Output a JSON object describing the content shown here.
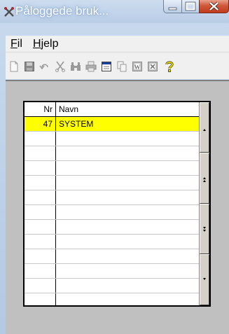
{
  "window": {
    "title": "Påloggede bruk...",
    "buttons": {
      "minimize": "—",
      "maximize": "☐",
      "close": "X"
    }
  },
  "menu": [
    {
      "label": "Fil",
      "mnemonic": "F",
      "rest": "il"
    },
    {
      "label": "Hjelp",
      "mnemonic": "H",
      "rest": "jelp"
    }
  ],
  "toolbar": {
    "icons": [
      "new-document-icon",
      "save-icon",
      "undo-icon",
      "cut-icon",
      "find-icon",
      "print-icon",
      "calendar-icon",
      "copy-icon",
      "word-export-icon",
      "excel-export-icon",
      "help-icon"
    ]
  },
  "grid": {
    "columns": [
      "Nr",
      "Navn"
    ],
    "rows": [
      {
        "nr": "47",
        "navn": "SYSTEM",
        "selected": true
      }
    ],
    "empty_row_count": 12,
    "selection_color": "#ffff00"
  },
  "scrollbar": {
    "buttons": [
      "up-icon",
      "page-up-icon",
      "page-down-icon",
      "down-icon"
    ]
  }
}
